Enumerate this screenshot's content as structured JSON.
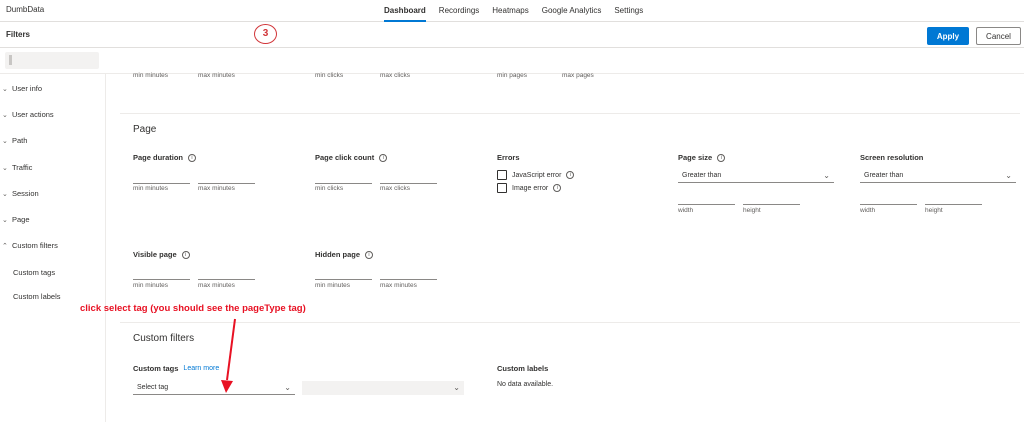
{
  "app": {
    "brand": "DumbData"
  },
  "nav": {
    "items": [
      "Dashboard",
      "Recordings",
      "Heatmaps",
      "Google Analytics",
      "Settings"
    ],
    "active": "Dashboard"
  },
  "filters": {
    "title": "Filters",
    "step": "3",
    "apply": "Apply",
    "cancel": "Cancel"
  },
  "sidebar": {
    "items": [
      "User info",
      "User actions",
      "Path",
      "Traffic",
      "Session",
      "Page",
      "Custom filters"
    ],
    "subitems": [
      "Custom tags",
      "Custom labels"
    ]
  },
  "top_row": {
    "min_minutes": "min minutes",
    "max_minutes": "max minutes",
    "min_clicks": "min clicks",
    "max_clicks": "max clicks",
    "min_pages": "min pages",
    "max_pages": "max pages"
  },
  "page": {
    "title": "Page",
    "duration": {
      "label": "Page duration",
      "min": "min minutes",
      "max": "max minutes"
    },
    "click_count": {
      "label": "Page click count",
      "min": "min clicks",
      "max": "max clicks"
    },
    "errors": {
      "label": "Errors",
      "options": [
        "JavaScript error",
        "Image error"
      ]
    },
    "page_size": {
      "label": "Page size",
      "selected": "Greater than",
      "width": "width",
      "height": "height"
    },
    "screen_resolution": {
      "label": "Screen resolution",
      "selected": "Greater than",
      "width": "width",
      "height": "height"
    },
    "visible_page": {
      "label": "Visible page",
      "min": "min minutes",
      "max": "max minutes"
    },
    "hidden_page": {
      "label": "Hidden page",
      "min": "min minutes",
      "max": "max minutes"
    }
  },
  "custom": {
    "title": "Custom filters",
    "tags_label": "Custom tags",
    "learn_more": "Learn more",
    "select_placeholder": "Select tag",
    "labels_title": "Custom labels",
    "no_data": "No data available."
  },
  "annotation": "click select tag (you should see the pageType tag)",
  "colors": {
    "accent": "#0078d4",
    "annotation": "#e81123"
  }
}
